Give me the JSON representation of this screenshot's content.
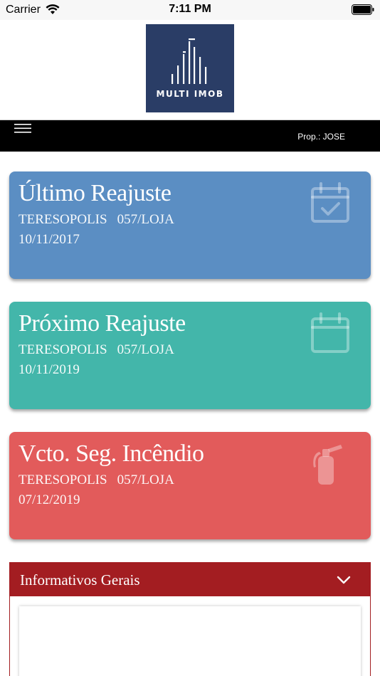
{
  "status_bar": {
    "carrier": "Carrier",
    "time": "7:11 PM"
  },
  "logo": {
    "text": "MULTI IMOB",
    "color": "#2a3d66"
  },
  "nav": {
    "prop_label": "Prop.: JOSE"
  },
  "cards": [
    {
      "title": "Último Reajuste",
      "city": "TERESOPOLIS",
      "unit": "057/LOJA",
      "date": "10/11/2017",
      "icon": "calendar-check-icon",
      "color": "#5b8ec3"
    },
    {
      "title": "Próximo Reajuste",
      "city": "TERESOPOLIS",
      "unit": "057/LOJA",
      "date": "10/11/2019",
      "icon": "calendar-icon",
      "color": "#43b6aa"
    },
    {
      "title": "Vcto. Seg. Incêndio",
      "city": "TERESOPOLIS",
      "unit": "057/LOJA",
      "date": "07/12/2019",
      "icon": "fire-extinguisher-icon",
      "color": "#e25b5b"
    }
  ],
  "info_panel": {
    "title": "Informativos Gerais",
    "color": "#a31d21"
  }
}
